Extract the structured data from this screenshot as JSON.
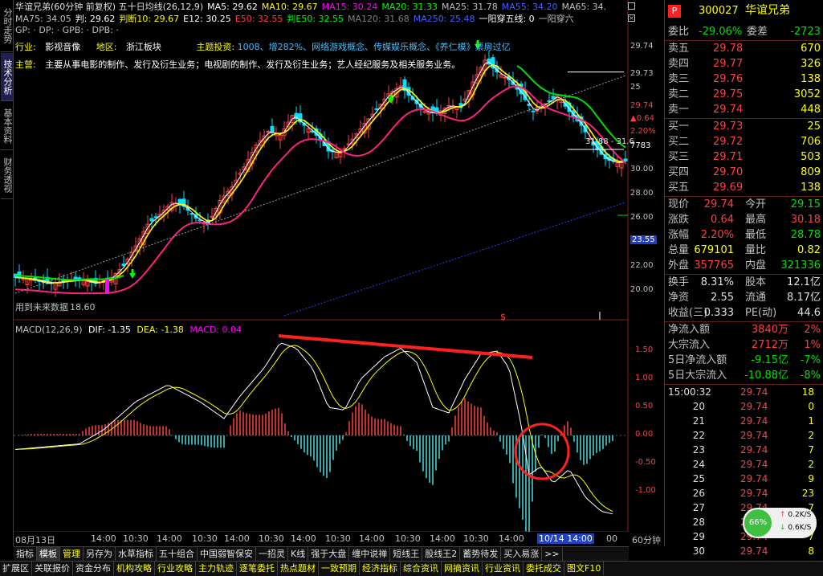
{
  "left_tabs": [
    "分时走势",
    "技术分析",
    "基本资料",
    "财务透视"
  ],
  "header": {
    "line1": [
      {
        "text": "华谊兄弟(60分钟 前复权) 五十日均线(26,12,9)",
        "color": "#e0e0e0"
      },
      {
        "text": "MA5: 29.62",
        "color": "#ffffff"
      },
      {
        "text": "MA10: 29.67",
        "color": "#ffff00"
      },
      {
        "text": "MA15: 30.24",
        "color": "#ff00ff"
      },
      {
        "text": "MA20: 31.33",
        "color": "#00ff00"
      },
      {
        "text": "MA25: 31.78",
        "color": "#c0c0c0"
      },
      {
        "text": "MA55: 34.20",
        "color": "#4060ff"
      },
      {
        "text": "MA65: 34.",
        "color": "#c0c0c0"
      }
    ],
    "line2": [
      {
        "text": "MA75: 34.05",
        "color": "#c0c0c0"
      },
      {
        "text": "判: 29.62",
        "color": "#ffffff"
      },
      {
        "text": "判断10: 29.67",
        "color": "#ffff00"
      },
      {
        "text": "E12: 30.25",
        "color": "#ffffff"
      },
      {
        "text": "E50: 32.55",
        "color": "#ff4040"
      },
      {
        "text": "判E50: 32.55",
        "color": "#00ff00"
      },
      {
        "text": "MA120: 31.68",
        "color": "#808080"
      },
      {
        "text": "MA250: 25.48",
        "color": "#4060ff"
      },
      {
        "text": "一阳穿五线: 0",
        "color": "#ffffff"
      },
      {
        "text": "一阳穿六",
        "color": "#c0c0c0"
      }
    ],
    "line3": "GP: · DP: · GPB: · DPB: ·",
    "industry_label": "行业:",
    "industry": "影视音像",
    "region_label": "地区:",
    "region": "浙江板块",
    "theme_label": "主题投资:",
    "theme": "1008、增282%、网络游戏概念、传媒娱乐概念、《养仁模》票房过亿",
    "main_label": "主营:",
    "main_business": "主要从事电影的制作、发行及衍生业务；电视剧的制作、发行及衍生业务；艺人经纪服务及相关服务业务。"
  },
  "price_axis": [
    "29.74",
    "29.73",
    "25",
    "29.74",
    "▲0.64",
    "2.20%",
    "7783",
    "30.00",
    "28.00",
    "26.00",
    "23.55",
    "22.00",
    "20.00"
  ],
  "price_annotations": {
    "ma_level": "31.88 - 31.6",
    "bottom_note": "用到未来数据",
    "low_label": "18.60",
    "dollar": "$"
  },
  "macd_header": {
    "name": "MACD(12,26,9)",
    "dif": "DIF: -1.35",
    "dea": "DEA: -1.38",
    "macd": "MACD: 0.04"
  },
  "macd_axis": [
    "1.50",
    "1.00",
    "0.50",
    "0.00",
    "-0.50",
    "-1.00"
  ],
  "time_axis": [
    "08月13日",
    "14:00",
    "10:30",
    "14:00",
    "10:30",
    "14:00",
    "10:30",
    "14:00",
    "10:30",
    "14:00",
    "10:30",
    "14:00",
    "10:30",
    "14:00",
    "10/14 14:00",
    "00"
  ],
  "period_label": "60分钟",
  "bottom_tabs1": [
    "指标",
    "模板",
    "管理",
    "另存为",
    "水草指标",
    "五十组合",
    "中国弱智保安",
    "一招灵",
    "K线",
    "强于大盘",
    "缠中说禅",
    "短线王",
    "股线王2",
    "蓄势待发",
    "买入易涨",
    ">>"
  ],
  "bottom_tabs2": [
    "扩展区",
    "关联报价",
    "资金分布",
    "机构攻略",
    "行业攻略",
    "主力轨迹",
    "逐笔委托",
    "热点题材",
    "一致预期",
    "经济指标",
    "综合资讯",
    "网摘资讯",
    "行业资讯",
    "委托成交",
    "图文F10"
  ],
  "quote": {
    "code": "300027",
    "name": "华谊兄弟",
    "weibi_label": "委比",
    "weibi": "-29.06%",
    "weicha_label": "委差",
    "weicha": "-2723",
    "asks": [
      {
        "label": "卖五",
        "price": "29.78",
        "vol": "670"
      },
      {
        "label": "卖四",
        "price": "29.77",
        "vol": "326"
      },
      {
        "label": "卖三",
        "price": "29.76",
        "vol": "138"
      },
      {
        "label": "卖二",
        "price": "29.75",
        "vol": "3052"
      },
      {
        "label": "卖一",
        "price": "29.74",
        "vol": "448"
      }
    ],
    "bids": [
      {
        "label": "买一",
        "price": "29.73",
        "vol": "25"
      },
      {
        "label": "买二",
        "price": "29.72",
        "vol": "706"
      },
      {
        "label": "买三",
        "price": "29.71",
        "vol": "503"
      },
      {
        "label": "买四",
        "price": "29.70",
        "vol": "809"
      },
      {
        "label": "买五",
        "price": "29.69",
        "vol": "138"
      }
    ],
    "stats": [
      {
        "l1": "现价",
        "v1": "29.74",
        "c1": "red",
        "l2": "今开",
        "v2": "29.15",
        "c2": "green"
      },
      {
        "l1": "涨跌",
        "v1": "0.64",
        "c1": "red",
        "l2": "最高",
        "v2": "30.18",
        "c2": "red"
      },
      {
        "l1": "涨幅",
        "v1": "2.20%",
        "c1": "red",
        "l2": "最低",
        "v2": "28.78",
        "c2": "green"
      },
      {
        "l1": "总量",
        "v1": "679101",
        "c1": "yel",
        "l2": "量比",
        "v2": "0.82",
        "c2": "yel"
      },
      {
        "l1": "外盘",
        "v1": "357765",
        "c1": "red",
        "l2": "内盘",
        "v2": "321336",
        "c2": "green"
      }
    ],
    "stats2": [
      {
        "l1": "换手",
        "v1": "8.31%",
        "l2": "股本",
        "v2": "12.1亿"
      },
      {
        "l1": "净资",
        "v1": "2.55",
        "l2": "流通",
        "v2": "8.17亿"
      },
      {
        "l1": "收益(三)",
        "v1": "0.333",
        "l2": "PE(动)",
        "v2": "44.6"
      }
    ],
    "flows": [
      {
        "l": "净流入额",
        "v": "3840万",
        "p": "2%",
        "c": "red"
      },
      {
        "l": "大宗流入",
        "v": "2712万",
        "p": "1%",
        "c": "red"
      },
      {
        "l": "5日净流入额",
        "v": "-9.15亿",
        "p": "-7%",
        "c": "green"
      },
      {
        "l": "5日大宗流入",
        "v": "-10.88亿",
        "p": "-8%",
        "c": "green"
      }
    ],
    "ticks": [
      {
        "t": "15:00:32",
        "p": "29.74",
        "v": "18"
      },
      {
        "t": "20",
        "p": "29.74",
        "v": "0"
      },
      {
        "t": "21",
        "p": "29.74",
        "v": "1"
      },
      {
        "t": "22",
        "p": "29.74",
        "v": "2"
      },
      {
        "t": "23",
        "p": "29.74",
        "v": "7"
      },
      {
        "t": "24",
        "p": "29.74",
        "v": "2"
      },
      {
        "t": "25",
        "p": "29.74",
        "v": "9"
      },
      {
        "t": "26",
        "p": "29.74",
        "v": "23"
      },
      {
        "t": "27",
        "p": "29.74",
        "v": "7"
      },
      {
        "t": "28",
        "p": "29.74",
        "v": "3"
      },
      {
        "t": "29",
        "p": "29.74",
        "v": "7"
      },
      {
        "t": "30",
        "p": "29.74",
        "v": "8"
      }
    ]
  },
  "widget": {
    "pct": "66%",
    "up": "0.2K/S",
    "down": "0.6K/S"
  },
  "colors": {
    "up": "#ff4040",
    "down": "#00e0ff",
    "ma_yellow": "#ffff00",
    "ma_pink": "#ff2080",
    "ma_green": "#00e000"
  }
}
